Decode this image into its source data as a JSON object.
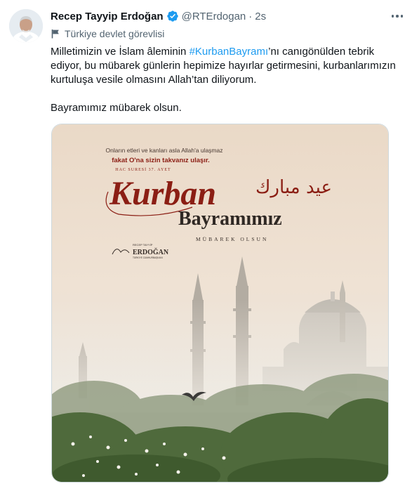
{
  "author": {
    "name": "Recep Tayyip Erdoğan",
    "handle": "@RTErdogan",
    "separator": "·",
    "time": "2s",
    "label": "Türkiye devlet görevlisi"
  },
  "tweet": {
    "line1_pre": "Milletimizin ve İslam âleminin ",
    "hashtag": "#KurbanBayramı",
    "line1_post": "’nı canıgönülden tebrik ediyor, bu mübarek günlerin hepimize hayırlar getirmesini, kurbanlarımızın kurtuluşa vesile olmasını Allah’tan diliyorum.",
    "line2": "Bayramımız mübarek olsun."
  },
  "poster": {
    "verse_line1": "Onların etleri ve kanları asla Allah'a ulaşmaz",
    "verse_line2": "fakat O'na sizin takvanız ulaşır.",
    "verse_source": "HAC SURESİ 37. AYET",
    "title_word1": "Kurban",
    "title_word2": "Bayramımız",
    "subtitle": "MÜBAREK OLSUN",
    "arabic": "عيد مبارك",
    "signature_small": "RECEP TAYYİP",
    "signature_name": "ERDOĞAN",
    "signature_title": "TÜRKİYE CUMHURBAŞKANI"
  },
  "colors": {
    "text": "#0f1419",
    "secondary": "#536471",
    "link": "#1d9bf0",
    "verified": "#1d9bf0",
    "poster_red": "#8b1e14",
    "poster_bg": "#efe1d1"
  }
}
